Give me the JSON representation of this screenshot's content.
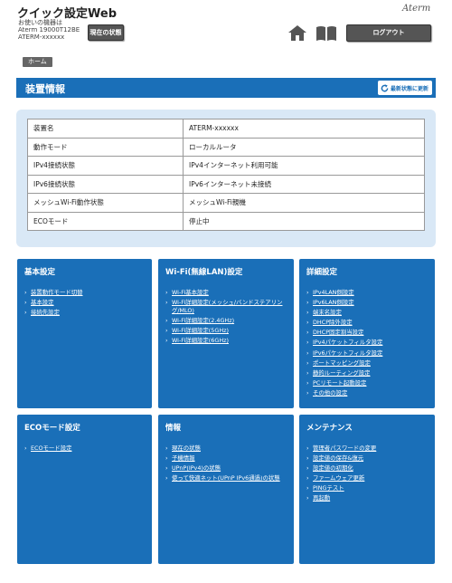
{
  "header": {
    "app_title": "クイック設定Web",
    "device_line1": "お使いの機器は",
    "device_line2": "Aterm 19000T12BE",
    "device_line3": "ATERM-xxxxxx",
    "status_button": "現在の状態",
    "brand": "Aterm",
    "home_icon": "home-icon",
    "manual_icon": "book-icon",
    "logout_button": "ログアウト"
  },
  "breadcrumb": {
    "home": "ホーム"
  },
  "page": {
    "title": "装置情報",
    "refresh_button": "最新状態に更新"
  },
  "device_info": [
    {
      "key": "装置名",
      "value": "ATERM-xxxxxx"
    },
    {
      "key": "動作モード",
      "value": "ローカルルータ"
    },
    {
      "key": "IPv4接続状態",
      "value": "IPv4インターネット利用可能"
    },
    {
      "key": "IPv6接続状態",
      "value": "IPv6インターネット未接続"
    },
    {
      "key": "メッシュWi-Fi動作状態",
      "value": "メッシュWi-Fi親機"
    },
    {
      "key": "ECOモード",
      "value": "停止中"
    }
  ],
  "tiles": {
    "basic": {
      "title": "基本設定",
      "links": [
        "装置動作モード切替",
        "基本設定",
        "接続先設定"
      ]
    },
    "wifi": {
      "title": "Wi-Fi(無線LAN)設定",
      "links": [
        "Wi-Fi基本設定",
        "Wi-Fi詳細設定(メッシュ/バンドステアリング/MLO)",
        "Wi-Fi詳細設定(2.4GHz)",
        "Wi-Fi詳細設定(5GHz)",
        "Wi-Fi詳細設定(6GHz)"
      ]
    },
    "advanced": {
      "title": "詳細設定",
      "links": [
        "IPv4LAN側設定",
        "IPv6LAN側設定",
        "端末名設定",
        "DHCP除外設定",
        "DHCP固定割当設定",
        "IPv4パケットフィルタ設定",
        "IPv6パケットフィルタ設定",
        "ポートマッピング設定",
        "静的ルーティング設定",
        "PCリモート起動設定",
        "その他の設定"
      ]
    },
    "eco": {
      "title": "ECOモード設定",
      "links": [
        "ECOモード設定"
      ]
    },
    "info": {
      "title": "情報",
      "links": [
        "現在の状態",
        "子機情報",
        "UPnP(IPv4)の状態",
        "使って快適ネット(UPnP IPv6通過)の状態"
      ]
    },
    "maintenance": {
      "title": "メンテナンス",
      "links": [
        "管理者パスワードの変更",
        "設定値の保存&復元",
        "設定値の初期化",
        "ファームウェア更新",
        "PINGテスト",
        "再起動"
      ]
    }
  },
  "colors": {
    "accent": "#1a6fb8",
    "panel": "#d9e8f6",
    "dark_button": "#555555"
  }
}
